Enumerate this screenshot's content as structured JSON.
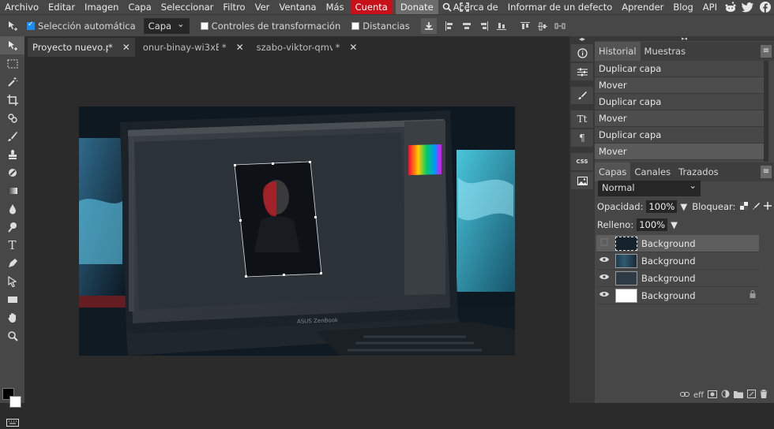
{
  "menu": {
    "items": [
      "Archivo",
      "Editar",
      "Imagen",
      "Capa",
      "Seleccionar",
      "Filtro",
      "Ver",
      "Ventana",
      "Más"
    ],
    "cuenta": "Cuenta",
    "donate": "Donate",
    "right_links": [
      "Acerca de",
      "Informar de un defecto",
      "Aprender",
      "Blog",
      "API"
    ],
    "colors": {
      "cuenta_bg": "#c8101a",
      "bar_bg": "#474747"
    }
  },
  "options": {
    "auto_select_label": "Selección automática",
    "auto_select_checked": true,
    "target_value": "Capa",
    "transform_label": "Controles de transformación",
    "distances_label": "Distancias"
  },
  "tabs": [
    {
      "name": "Proyecto nuevo.psd",
      "modified": "*",
      "close": "✕"
    },
    {
      "name": "onur-binay-wi3xBn",
      "modified": "*",
      "close": "✕"
    },
    {
      "name": "szabo-viktor-qmvl",
      "modified": "*",
      "close": "✕"
    }
  ],
  "canvas": {
    "laptop_brand": "ASUS ZenBook"
  },
  "history": {
    "tabs": [
      "Historial",
      "Muestras"
    ],
    "menu": "≡",
    "rows": [
      "Duplicar capa",
      "Mover",
      "Duplicar capa",
      "Mover",
      "Duplicar capa",
      "Mover"
    ]
  },
  "layers": {
    "tabs": [
      "Capas",
      "Canales",
      "Trazados"
    ],
    "menu": "≡",
    "blend_mode": "Normal",
    "opacity_label": "Opacidad:",
    "opacity_value": "100%",
    "lock_label": "Bloquear:",
    "fill_label": "Relleno:",
    "fill_value": "100%",
    "items": [
      {
        "name": "Background",
        "visible": false,
        "selected": true,
        "locked": false
      },
      {
        "name": "Background",
        "visible": true,
        "selected": false,
        "locked": false
      },
      {
        "name": "Background",
        "visible": true,
        "selected": false,
        "locked": false
      },
      {
        "name": "Background",
        "visible": true,
        "selected": false,
        "locked": true
      }
    ],
    "footer_eff": "eff"
  }
}
